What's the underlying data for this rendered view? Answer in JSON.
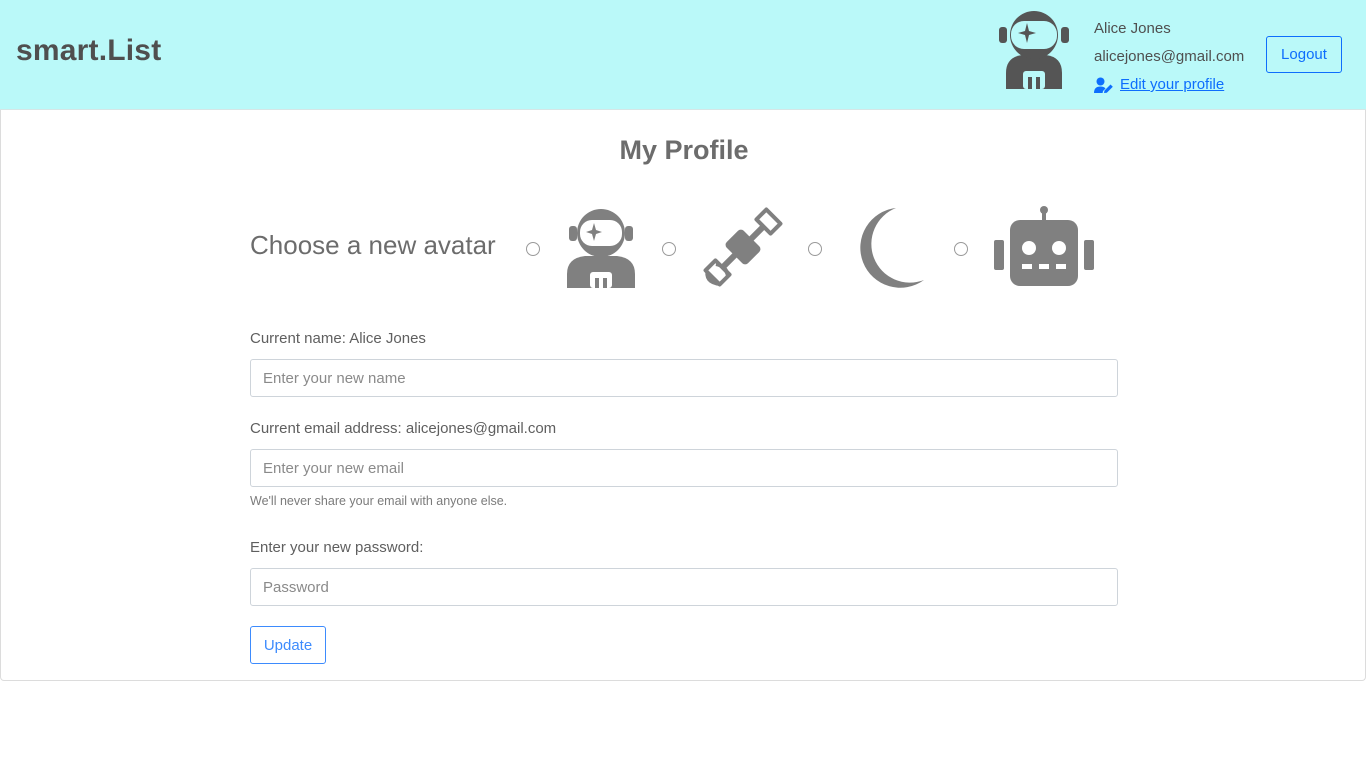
{
  "navbar": {
    "brand": "smart.List",
    "user": {
      "name": "Alice Jones",
      "email": "alicejones@gmail.com",
      "edit_link": " Edit your profile",
      "avatar_icon": "astronaut-icon"
    },
    "logout_label": "Logout"
  },
  "profile": {
    "title": "My Profile",
    "avatar_heading": "Choose a new avatar",
    "avatar_options": [
      {
        "icon": "astronaut-icon",
        "selected": false
      },
      {
        "icon": "satellite-icon",
        "selected": false
      },
      {
        "icon": "moon-icon",
        "selected": false
      },
      {
        "icon": "robot-icon",
        "selected": false
      }
    ],
    "name_label": "Current name: Alice Jones",
    "name_placeholder": "Enter your new name",
    "email_label": "Current email address: alicejones@gmail.com",
    "email_placeholder": "Enter your new email",
    "email_help": "We'll never share your email with anyone else.",
    "password_label": "Enter your new password:",
    "password_placeholder": "Password",
    "update_label": "Update"
  },
  "colors": {
    "navbar_bg": "#baf9f9",
    "accent": "#0d6efd",
    "icon_gray": "#808080",
    "nav_icon": "#555555"
  }
}
